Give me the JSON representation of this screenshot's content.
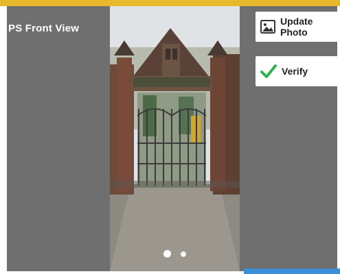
{
  "header": {
    "title": "PS Front View"
  },
  "photo": {
    "carousel_total": 2,
    "carousel_active": 1,
    "gate_sign_text": ""
  },
  "actions": {
    "update_photo_label": "Update Photo",
    "verify_label": "Verify"
  },
  "icons": {
    "update_photo": "photo-icon",
    "verify": "check-icon"
  },
  "colors": {
    "top_bar": "#e9b92d",
    "panel": "#6f6f6f",
    "check": "#2bb34a",
    "bottom_accent": "#3a8fd8"
  }
}
